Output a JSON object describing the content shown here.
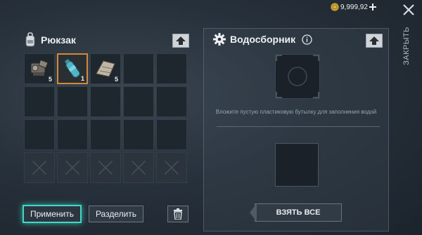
{
  "topbar": {
    "currency_amount": "9,999,92",
    "currency_icon": "coin-icon",
    "add_icon": "plus-icon",
    "close_icon": "close-icon",
    "close_label": "ЗАКРЫТЬ"
  },
  "backpack": {
    "title": "Рюкзак",
    "icon": "backpack-icon",
    "sort_icon": "arrow-up-icon",
    "slots": [
      {
        "item": "scrap-parts",
        "qty": "5",
        "selected": false
      },
      {
        "item": "plastic-bottle",
        "qty": "1",
        "selected": true
      },
      {
        "item": "cloth-bundle",
        "qty": "5",
        "selected": false
      },
      {
        "item": "",
        "qty": "",
        "selected": false
      },
      {
        "item": "",
        "qty": "",
        "selected": false
      }
    ],
    "locked_slot_count_label": ""
  },
  "actions": {
    "apply_label": "Применить",
    "split_label": "Разделить",
    "trash_icon": "trash-icon"
  },
  "collector": {
    "title": "Водосборник",
    "gear_icon": "gear-icon",
    "info_icon": "info-icon",
    "sort_icon": "arrow-up-icon",
    "hint": "Вложите пустую пластиковую бутылку для заполнения водой",
    "take_all_label": "ВЗЯТЬ ВСЕ"
  },
  "colors": {
    "selected_border": "#d08a3a",
    "primary_glow": "#40d9c8"
  }
}
